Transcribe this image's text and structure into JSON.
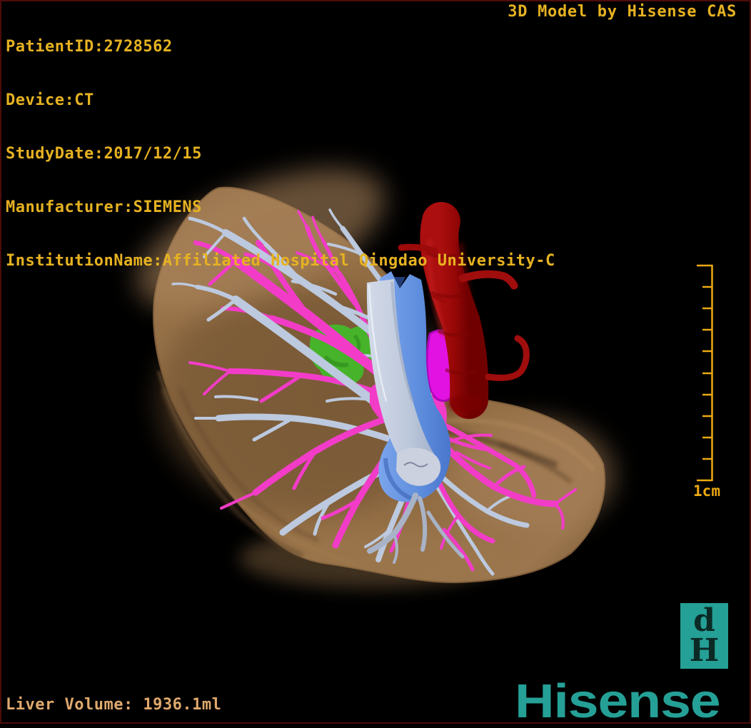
{
  "overlay": {
    "patient_lines": [
      "PatientID:2728562",
      "Device:CT",
      "StudyDate:2017/12/15",
      "Manufacturer:SIEMENS",
      "InstitutionName:Affiliated Hospital Qingdao University-C"
    ],
    "title": "3D Model by Hisense CAS",
    "liver_volume": "Liver Volume: 1936.1ml",
    "scale_label": "1cm"
  },
  "branding": {
    "wordmark": "Hisense",
    "mark_top": "d",
    "mark_bottom": "H"
  },
  "colors": {
    "annotation_text": "#e6b222",
    "volume_text": "#dfa96d",
    "scale_bar": "#eda912",
    "brand_teal": "#25a096",
    "border": "#4f0b0b",
    "liver": "#96714a",
    "portal_vein": "#f23cc8",
    "hepatic_vein": "#bcc9de",
    "ivc_blue": "#6d9ae6",
    "aorta_red": "#9c0c0c",
    "tumor_green": "#46b32a",
    "lesion_magenta": "#e212e2"
  }
}
